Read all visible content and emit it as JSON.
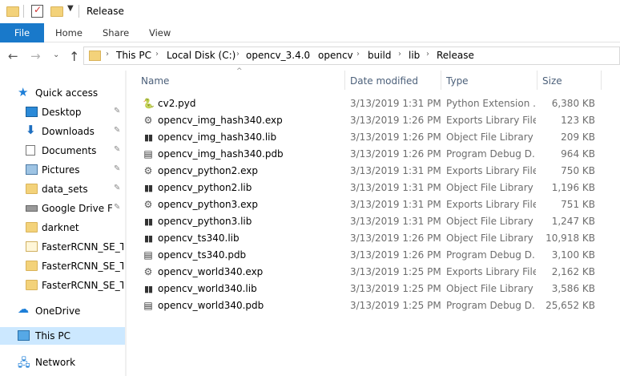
{
  "window": {
    "title": "Release"
  },
  "ribbon": {
    "tabs": [
      "File",
      "Home",
      "Share",
      "View"
    ]
  },
  "nav": {
    "back_glyph": "←",
    "forward_glyph": "→",
    "recent_glyph": "⌄",
    "up_glyph": "↑",
    "breadcrumb": [
      "This PC",
      "Local Disk (C:)",
      "opencv_3.4.0",
      "opencv",
      "build",
      "lib",
      "Release"
    ],
    "separator": "›"
  },
  "sidebar": {
    "quick_access": "Quick access",
    "pinned": [
      {
        "label": "Desktop",
        "icon": "desktop-icon",
        "pinned": true
      },
      {
        "label": "Downloads",
        "icon": "downloads-icon",
        "pinned": true
      },
      {
        "label": "Documents",
        "icon": "documents-icon",
        "pinned": true
      },
      {
        "label": "Pictures",
        "icon": "pictures-icon",
        "pinned": true
      },
      {
        "label": "data_sets",
        "icon": "folder-icon",
        "pinned": true
      },
      {
        "label": "Google Drive File",
        "icon": "drive-icon",
        "pinned": true
      },
      {
        "label": "darknet",
        "icon": "folder-icon",
        "pinned": false
      },
      {
        "label": "FasterRCNN_SE_Tes",
        "icon": "folder-outline-icon",
        "pinned": false
      },
      {
        "label": "FasterRCNN_SE_Tes",
        "icon": "folder-icon",
        "pinned": false
      },
      {
        "label": "FasterRCNN_SE_Tra",
        "icon": "folder-icon",
        "pinned": false
      }
    ],
    "onedrive": "OneDrive",
    "this_pc": "This PC",
    "network": "Network",
    "pin_glyph": "📌"
  },
  "columns": {
    "name": "Name",
    "date": "Date modified",
    "type": "Type",
    "size": "Size",
    "sort_glyph": "^"
  },
  "files": [
    {
      "name": "cv2.pyd",
      "date": "3/13/2019 1:31 PM",
      "type": "Python Extension ...",
      "size": "6,380 KB",
      "icon": "python-file-icon"
    },
    {
      "name": "opencv_img_hash340.exp",
      "date": "3/13/2019 1:26 PM",
      "type": "Exports Library File",
      "size": "123 KB",
      "icon": "exp-file-icon"
    },
    {
      "name": "opencv_img_hash340.lib",
      "date": "3/13/2019 1:26 PM",
      "type": "Object File Library",
      "size": "209 KB",
      "icon": "lib-file-icon"
    },
    {
      "name": "opencv_img_hash340.pdb",
      "date": "3/13/2019 1:26 PM",
      "type": "Program Debug D...",
      "size": "964 KB",
      "icon": "pdb-file-icon"
    },
    {
      "name": "opencv_python2.exp",
      "date": "3/13/2019 1:31 PM",
      "type": "Exports Library File",
      "size": "750 KB",
      "icon": "exp-file-icon"
    },
    {
      "name": "opencv_python2.lib",
      "date": "3/13/2019 1:31 PM",
      "type": "Object File Library",
      "size": "1,196 KB",
      "icon": "lib-file-icon"
    },
    {
      "name": "opencv_python3.exp",
      "date": "3/13/2019 1:31 PM",
      "type": "Exports Library File",
      "size": "751 KB",
      "icon": "exp-file-icon"
    },
    {
      "name": "opencv_python3.lib",
      "date": "3/13/2019 1:31 PM",
      "type": "Object File Library",
      "size": "1,247 KB",
      "icon": "lib-file-icon"
    },
    {
      "name": "opencv_ts340.lib",
      "date": "3/13/2019 1:26 PM",
      "type": "Object File Library",
      "size": "10,918 KB",
      "icon": "lib-file-icon"
    },
    {
      "name": "opencv_ts340.pdb",
      "date": "3/13/2019 1:26 PM",
      "type": "Program Debug D...",
      "size": "3,100 KB",
      "icon": "pdb-file-icon"
    },
    {
      "name": "opencv_world340.exp",
      "date": "3/13/2019 1:25 PM",
      "type": "Exports Library File",
      "size": "2,162 KB",
      "icon": "exp-file-icon"
    },
    {
      "name": "opencv_world340.lib",
      "date": "3/13/2019 1:25 PM",
      "type": "Object File Library",
      "size": "3,586 KB",
      "icon": "lib-file-icon"
    },
    {
      "name": "opencv_world340.pdb",
      "date": "3/13/2019 1:25 PM",
      "type": "Program Debug D...",
      "size": "25,652 KB",
      "icon": "pdb-file-icon"
    }
  ],
  "icons": {
    "python-file-icon": "🐍",
    "exp-file-icon": "⚙",
    "lib-file-icon": "▮▮",
    "pdb-file-icon": "▤"
  },
  "colors": {
    "file_tab": "#1979ca",
    "selected": "#cce8ff",
    "header_text": "#4c607a",
    "secondary_text": "#6d6d6d"
  }
}
